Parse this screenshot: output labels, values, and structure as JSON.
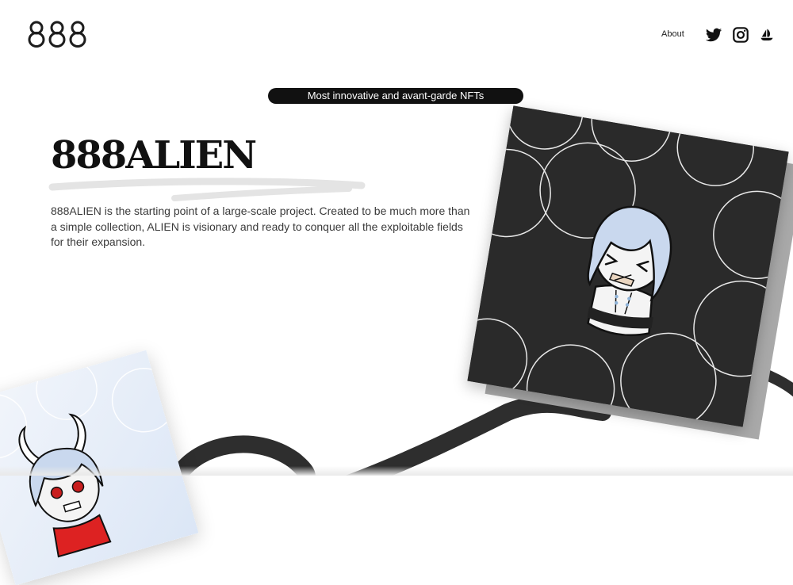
{
  "header": {
    "logo_text": "888",
    "nav": {
      "about_label": "About"
    },
    "social": [
      {
        "icon": "twitter-icon"
      },
      {
        "icon": "instagram-icon"
      },
      {
        "icon": "opensea-icon"
      }
    ]
  },
  "hero": {
    "tagline": "Most innovative and avant-garde NFTs",
    "title": "888ALIEN",
    "description": "888ALIEN is the starting point of a large-scale project. Created to be much more than a simple collection, ALIEN is visionary and ready to conquer all the exploitable fields for their expansion."
  },
  "colors": {
    "text": "#1d1d1d",
    "pill_bg": "#111111",
    "card_dark": "#2a2a2a",
    "card_shadow": "#a9a9a9"
  }
}
